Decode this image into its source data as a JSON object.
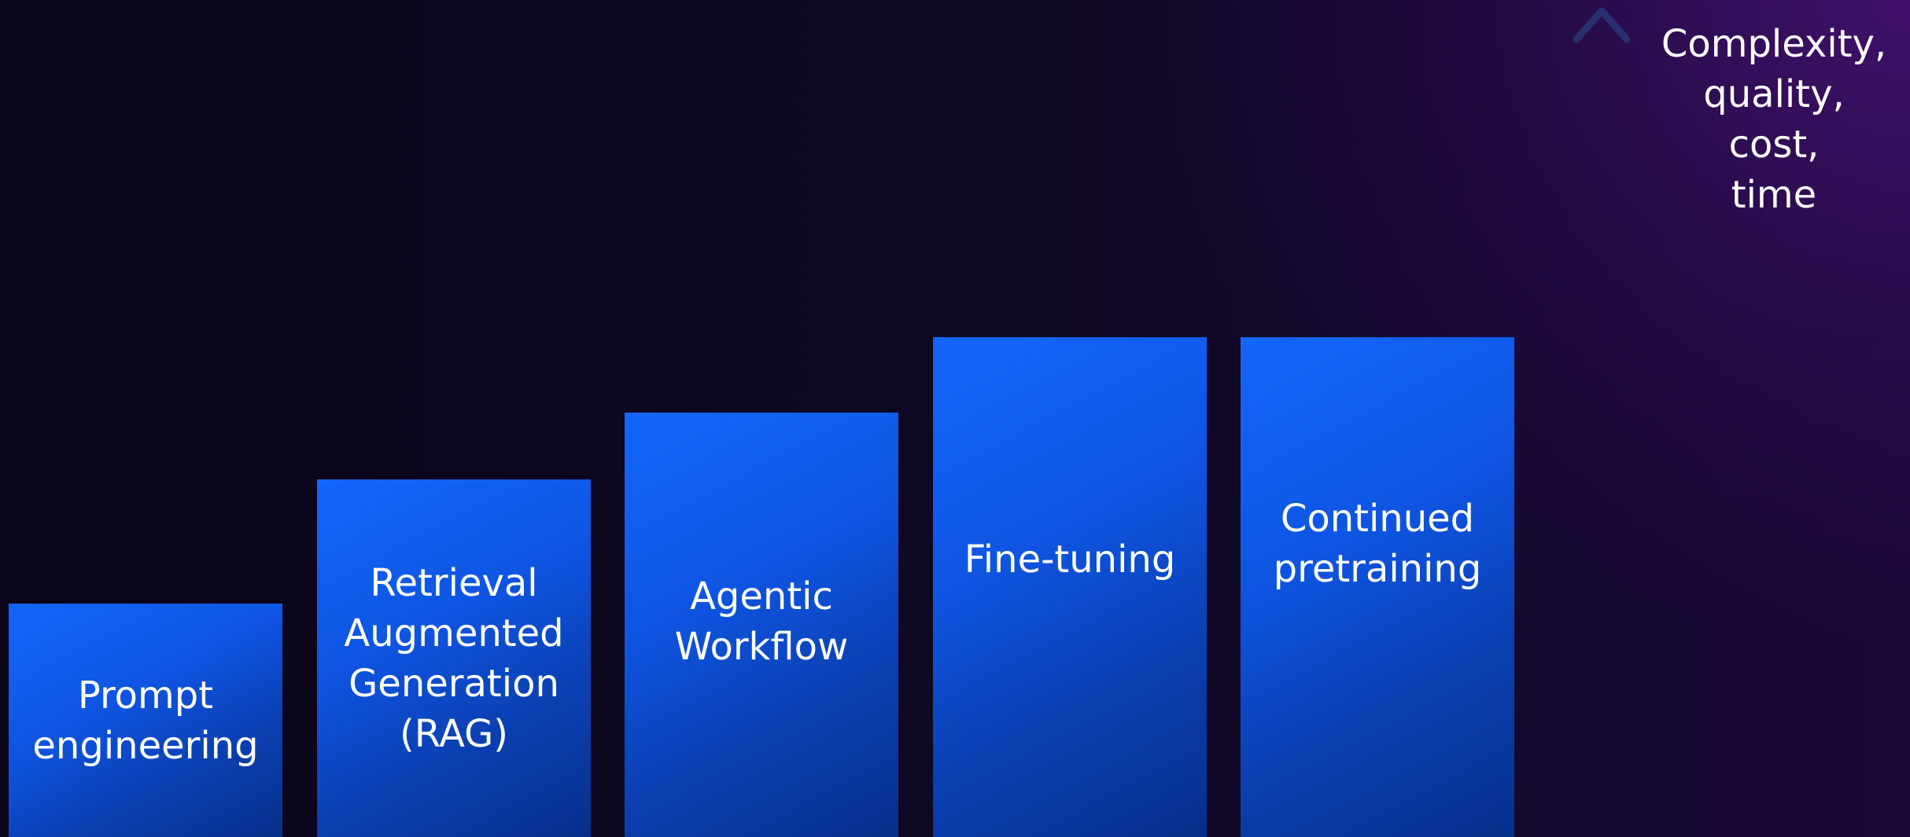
{
  "bars": [
    {
      "label": "Prompt\nengineering"
    },
    {
      "label": "Retrieval\nAugmented\nGeneration\n(RAG)"
    },
    {
      "label": "Agentic\nWorkflow"
    },
    {
      "label": "Fine-tuning"
    },
    {
      "label": "Continued\npretraining"
    }
  ],
  "axis": {
    "label": "Complexity,\nquality,\ncost,\ntime",
    "direction": "up"
  },
  "colors": {
    "bar_top": "#1366fb",
    "bar_bottom": "#072f8a",
    "arrow_top": "#2a2f70",
    "arrow_bottom": "#1fe39a",
    "background": "#0a0519"
  }
}
